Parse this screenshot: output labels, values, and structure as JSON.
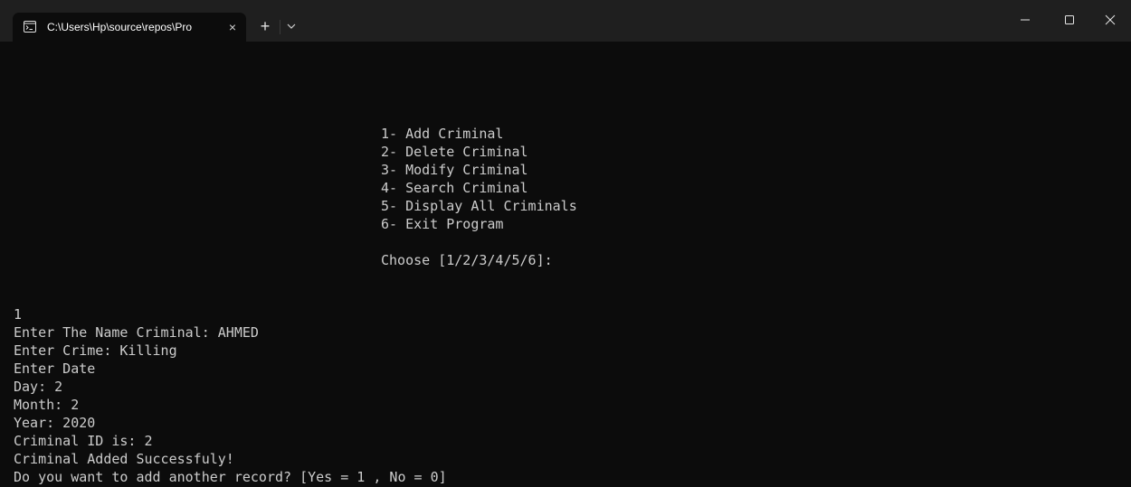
{
  "titlebar": {
    "tab_title": "C:\\Users\\Hp\\source\\repos\\Pro",
    "tab_icon": "console-icon",
    "close_tab_icon": "×",
    "new_tab_label": "+",
    "dropdown_icon": "chevron-down-icon"
  },
  "window_controls": {
    "minimize": "minimize-icon",
    "maximize": "maximize-icon",
    "close": "close-icon"
  },
  "colors": {
    "background": "#0c0c0c",
    "text": "#cccccc",
    "titlebar": "#1f1f1f"
  },
  "menu": {
    "items": [
      "1- Add Criminal",
      "2- Delete Criminal",
      "3- Modify Criminal",
      "4- Search Criminal",
      "5- Display All Criminals",
      "6- Exit Program"
    ],
    "prompt": "Choose [1/2/3/4/5/6]:"
  },
  "output": {
    "lines": [
      "1",
      "Enter The Name Criminal: AHMED",
      "Enter Crime: Killing",
      "Enter Date",
      "Day: 2",
      "Month: 2",
      "Year: 2020",
      "Criminal ID is: 2",
      "Criminal Added Successfuly!",
      "Do you want to add another record? [Yes = 1 , No = 0]"
    ]
  }
}
